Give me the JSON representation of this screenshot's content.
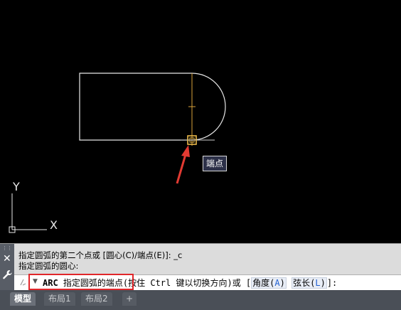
{
  "canvas": {
    "tooltip": "端点",
    "ucs_y": "Y",
    "ucs_x": "X"
  },
  "command": {
    "history": [
      "指定圆弧的第二个点或 [圆心(C)/端点(E)]: _c",
      "指定圆弧的圆心:"
    ],
    "prompt_cmd": "ARC",
    "prompt_text": " 指定圆弧的端点(按住 Ctrl 键以切换方向)或 [",
    "options": [
      {
        "label": "角度(",
        "key": "A",
        "close": ")"
      },
      {
        "label": "弦长(",
        "key": "L",
        "close": ")"
      }
    ],
    "prompt_end": "]:"
  },
  "tabs": [
    {
      "label": "模型",
      "active": true
    },
    {
      "label": "布局1",
      "active": false
    },
    {
      "label": "布局2",
      "active": false
    },
    {
      "label": "+",
      "active": false
    }
  ],
  "colors": {
    "drawing": "#e8e8e8",
    "crosshair": "#d9a23a",
    "snap": "#e8b84a",
    "arrow": "#e23a32",
    "highlight": "#e1262a"
  }
}
